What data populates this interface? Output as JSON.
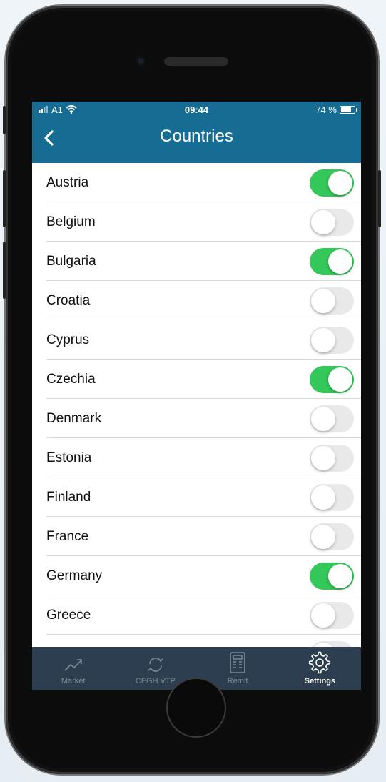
{
  "status": {
    "carrier": "A1",
    "time": "09:44",
    "battery": "74 %"
  },
  "header": {
    "title": "Countries"
  },
  "countries": [
    {
      "name": "Austria",
      "on": true
    },
    {
      "name": "Belgium",
      "on": false
    },
    {
      "name": "Bulgaria",
      "on": true
    },
    {
      "name": "Croatia",
      "on": false
    },
    {
      "name": "Cyprus",
      "on": false
    },
    {
      "name": "Czechia",
      "on": true
    },
    {
      "name": "Denmark",
      "on": false
    },
    {
      "name": "Estonia",
      "on": false
    },
    {
      "name": "Finland",
      "on": false
    },
    {
      "name": "France",
      "on": false
    },
    {
      "name": "Germany",
      "on": true
    },
    {
      "name": "Greece",
      "on": false
    },
    {
      "name": "",
      "on": false
    }
  ],
  "tabs": [
    {
      "label": "Market",
      "icon": "trend-up-icon",
      "active": false
    },
    {
      "label": "CEGH VTP",
      "icon": "refresh-icon",
      "active": false
    },
    {
      "label": "Remit",
      "icon": "calculator-icon",
      "active": false
    },
    {
      "label": "Settings",
      "icon": "gear-icon",
      "active": true
    }
  ],
  "colors": {
    "header": "#176c94",
    "toggle_on": "#34c759",
    "toggle_off": "#e9e9ea",
    "tabbar": "#2c3e50"
  }
}
